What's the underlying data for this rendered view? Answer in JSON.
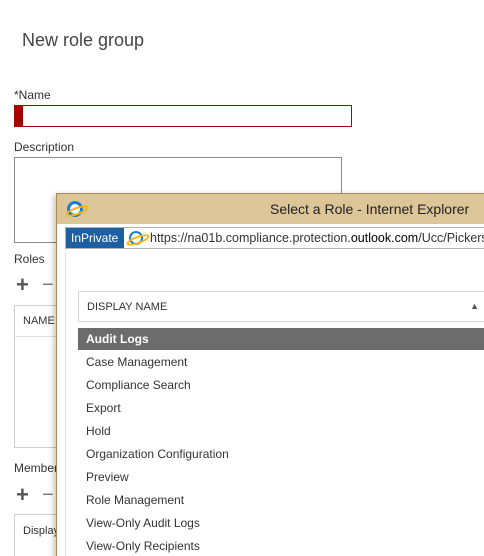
{
  "form": {
    "title": "New role group",
    "name_label": "*Name",
    "name_value": "",
    "description_label": "Description",
    "description_value": "",
    "roles_label": "Roles",
    "roles_column": "NAME",
    "members_label": "Member",
    "members_column": "Display",
    "add_symbol": "+",
    "remove_symbol": "−"
  },
  "popup": {
    "window_title": "Select a Role - Internet Explorer",
    "inprivate_label": "InPrivate",
    "url_prefix": "https://na01b.compliance.protection.",
    "url_host": "outlook.com",
    "url_suffix": "/Ucc/Pickers/",
    "column_header": "DISPLAY NAME",
    "sort_glyph": "▲",
    "roles": [
      "Audit Logs",
      "Case Management",
      "Compliance Search",
      "Export",
      "Hold",
      "Organization Configuration",
      "Preview",
      "Role Management",
      "View-Only Audit Logs",
      "View-Only Recipients"
    ],
    "selected_index": 0
  },
  "colors": {
    "error_red": "#a80000",
    "titlebar": "#dcc597",
    "inprivate_blue": "#1c5fa3",
    "selected_row": "#6c6c6c"
  }
}
